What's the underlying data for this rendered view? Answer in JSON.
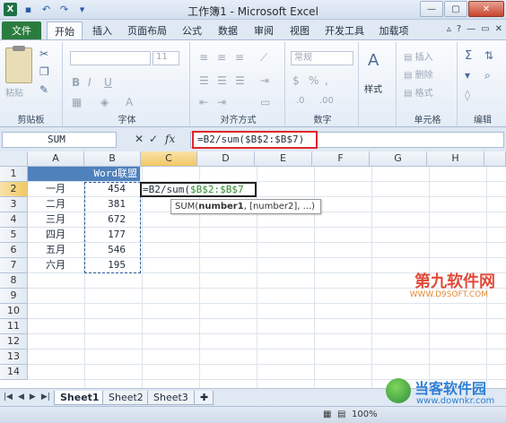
{
  "window": {
    "title": "工作簿1 - Microsoft Excel"
  },
  "tabs": [
    "文件",
    "开始",
    "插入",
    "页面布局",
    "公式",
    "数据",
    "审阅",
    "视图",
    "开发工具",
    "加载项"
  ],
  "ribbon": {
    "groups": [
      {
        "label": "剪贴板",
        "main": "粘贴"
      },
      {
        "label": "字体",
        "font_size": "11"
      },
      {
        "label": "对齐方式"
      },
      {
        "label": "数字",
        "format": "常规"
      },
      {
        "label": "",
        "main": "样式"
      },
      {
        "label": "单元格",
        "items": [
          "插入",
          "删除",
          "格式"
        ]
      },
      {
        "label": "编辑"
      }
    ]
  },
  "formula_bar": {
    "name_box": "SUM",
    "fx": "fx",
    "formula": "=B2/sum($B$2:$B$7)"
  },
  "columns": [
    "A",
    "B",
    "C",
    "D",
    "E",
    "F",
    "G",
    "H"
  ],
  "rows": [
    "1",
    "2",
    "3",
    "4",
    "5",
    "6",
    "7",
    "8",
    "9",
    "10",
    "11",
    "12",
    "13",
    "14"
  ],
  "sheet": {
    "header_b1": "Word联盟",
    "labels": [
      "一月",
      "二月",
      "三月",
      "四月",
      "五月",
      "六月"
    ],
    "values": [
      "454",
      "381",
      "672",
      "177",
      "546",
      "195"
    ],
    "active_cell_prefix": "=B2/sum(",
    "active_cell_ref": "$B$2:$B$7",
    "tooltip_pre": "SUM(",
    "tooltip_bold": "number1",
    "tooltip_post": ", [number2], ...)"
  },
  "sheet_tabs": [
    "Sheet1",
    "Sheet2",
    "Sheet3"
  ],
  "status": {
    "zoom": "100%"
  },
  "watermarks": {
    "w1": "第九软件网",
    "w1_url": "WWW.D9SOFT.COM",
    "w2": "当客软件园",
    "w2_url": "www.downkr.com"
  }
}
